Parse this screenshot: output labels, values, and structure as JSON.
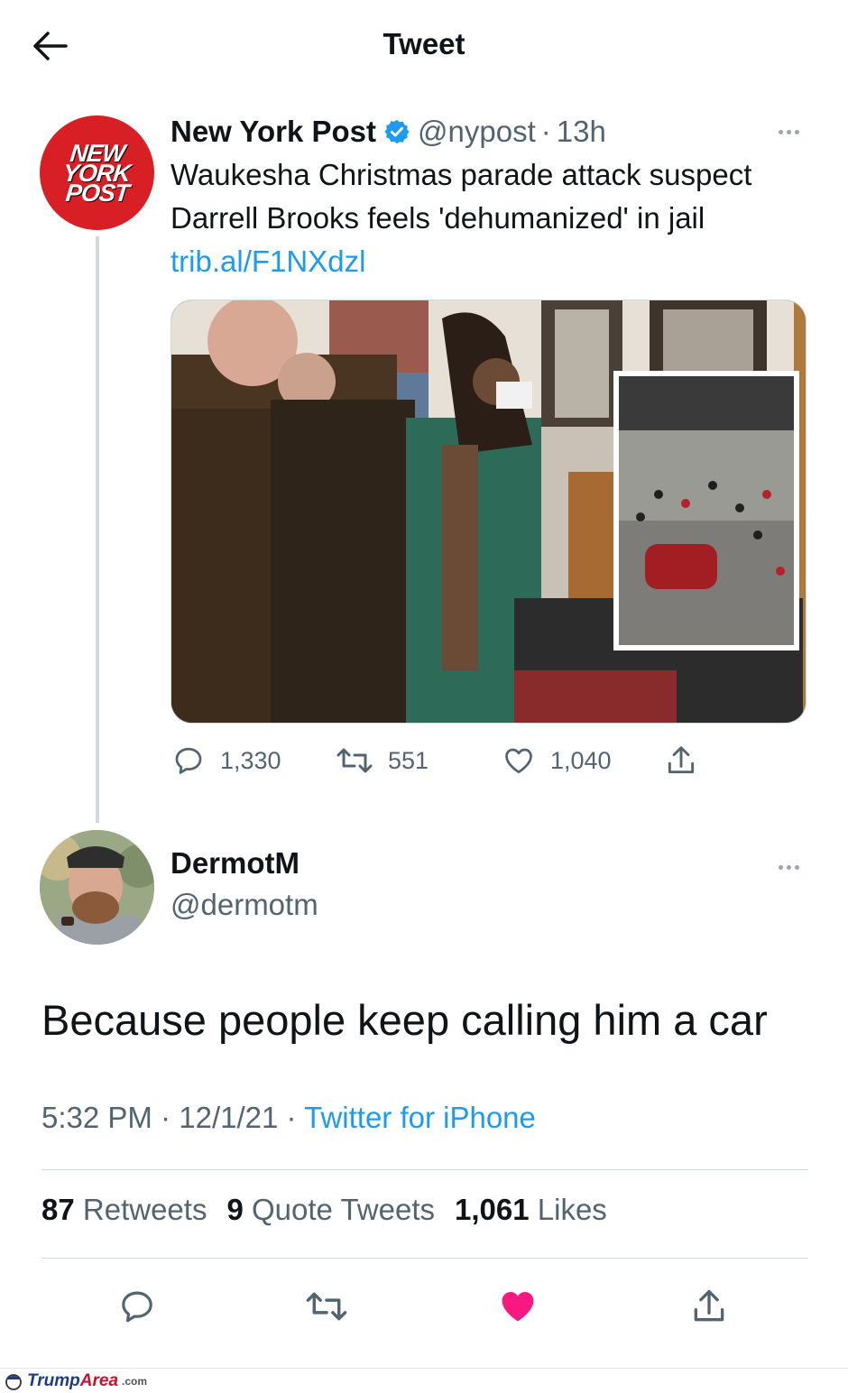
{
  "header": {
    "title": "Tweet",
    "back_icon": "arrow-left-icon"
  },
  "quoted_tweet": {
    "avatar_lines": [
      "NEW",
      "YORK",
      "POST"
    ],
    "name": "New York Post",
    "handle": "@nypost",
    "separator": "·",
    "time": "13h",
    "text": "Waukesha Christmas parade attack suspect Darrell Brooks feels 'dehumanized' in jail ",
    "link": "trib.al/F1NXdzl",
    "actions": {
      "replies": "1,330",
      "retweets": "551",
      "likes": "1,040"
    }
  },
  "reply_tweet": {
    "name": "DermotM",
    "handle": "@dermotm",
    "text": "Because people keep calling him a car",
    "time": "5:32 PM",
    "date": "12/1/21",
    "separator": "·",
    "source": "Twitter for iPhone",
    "stats": {
      "retweets_count": "87",
      "retweets_label": "Retweets",
      "quotes_count": "9",
      "quotes_label": "Quote Tweets",
      "likes_count": "1,061",
      "likes_label": "Likes"
    },
    "liked": true
  },
  "footer": {
    "brand_a": "Trump",
    "brand_b": "Area",
    "domain": ".com"
  },
  "colors": {
    "accent": "#1d9bf0",
    "like": "#f91880",
    "brand_red": "#d81f26",
    "muted": "#536471"
  }
}
